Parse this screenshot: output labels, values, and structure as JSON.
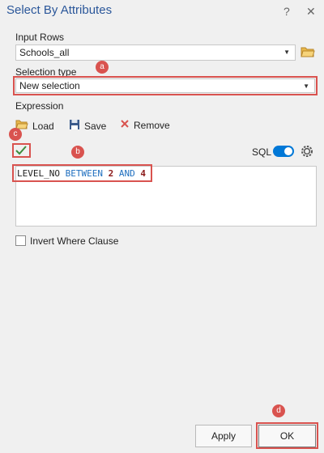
{
  "window": {
    "title": "Select By Attributes",
    "help": "?",
    "close": "✕"
  },
  "input_rows": {
    "label": "Input Rows",
    "value": "Schools_all"
  },
  "selection_type": {
    "label": "Selection type",
    "value": "New selection"
  },
  "expression": {
    "label": "Expression",
    "load": "Load",
    "save": "Save",
    "remove": "Remove",
    "sql": "SQL"
  },
  "query": {
    "field": "LEVEL_NO",
    "op1": "BETWEEN",
    "v1": "2",
    "op2": "AND",
    "v2": "4"
  },
  "invert": {
    "label": "Invert Where Clause"
  },
  "buttons": {
    "apply": "Apply",
    "ok": "OK"
  },
  "badges": {
    "a": "a",
    "b": "b",
    "c": "c",
    "d": "d"
  },
  "colors": {
    "accent": "#0078d7",
    "highlight": "#d9534f",
    "keyword": "#1f6fbf",
    "number": "#8b1a1a"
  }
}
